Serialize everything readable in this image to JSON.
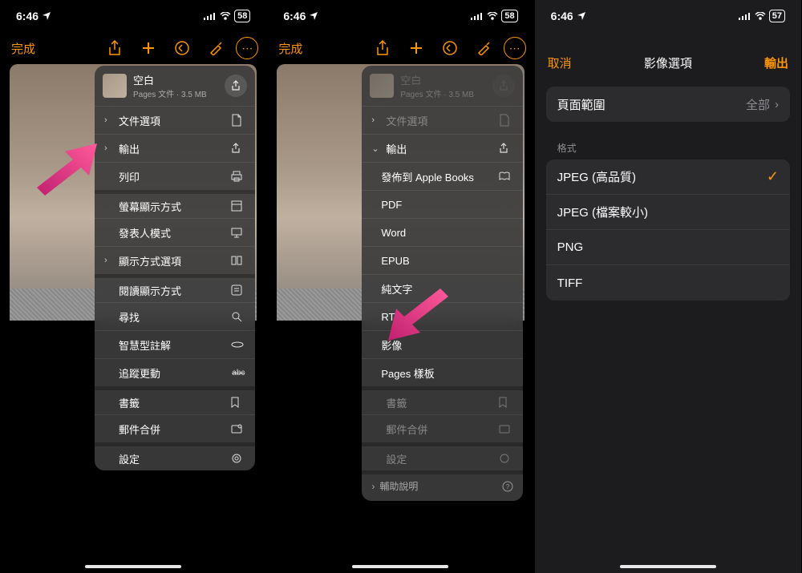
{
  "status": {
    "time": "6:46",
    "location_icon": "◤",
    "battery_1_2": "58",
    "battery_3": "57"
  },
  "toolbar": {
    "done": "完成"
  },
  "popover": {
    "doc_title": "空白",
    "doc_sub": "Pages 文件 · 3.5 MB",
    "items": [
      {
        "label": "文件選項",
        "chev": true,
        "icon": "doc"
      },
      {
        "label": "輸出",
        "chev": true,
        "icon": "share"
      },
      {
        "label": "列印",
        "chev": false,
        "icon": "print"
      }
    ],
    "group2": [
      {
        "label": "螢幕顯示方式",
        "chev": false,
        "icon": "layout"
      },
      {
        "label": "發表人模式",
        "chev": false,
        "icon": "present"
      },
      {
        "label": "顯示方式選項",
        "chev": true,
        "icon": "split"
      }
    ],
    "group3": [
      {
        "label": "閱讀顯示方式",
        "icon": "read"
      },
      {
        "label": "尋找",
        "icon": "search"
      },
      {
        "label": "智慧型註解",
        "icon": "annot"
      },
      {
        "label": "追蹤更動",
        "icon": "track"
      }
    ],
    "group4": [
      {
        "label": "書籤",
        "icon": "bookmark"
      },
      {
        "label": "郵件合併",
        "icon": "mail"
      }
    ],
    "group5": [
      {
        "label": "設定",
        "icon": "gear"
      }
    ],
    "expanded_export": [
      {
        "label": "發佈到 Apple Books",
        "icon": "book"
      },
      {
        "label": "PDF"
      },
      {
        "label": "Word"
      },
      {
        "label": "EPUB"
      },
      {
        "label": "純文字"
      },
      {
        "label": "RTF"
      },
      {
        "label": "影像"
      },
      {
        "label": "Pages 樣板"
      }
    ],
    "help": "輔助說明"
  },
  "image_opts": {
    "cancel": "取消",
    "title": "影像選項",
    "export": "輸出",
    "page_range_label": "頁面範圍",
    "page_range_value": "全部",
    "format_label": "格式",
    "formats": [
      {
        "label": "JPEG (高品質)",
        "selected": true
      },
      {
        "label": "JPEG (檔案較小)"
      },
      {
        "label": "PNG"
      },
      {
        "label": "TIFF"
      }
    ]
  }
}
